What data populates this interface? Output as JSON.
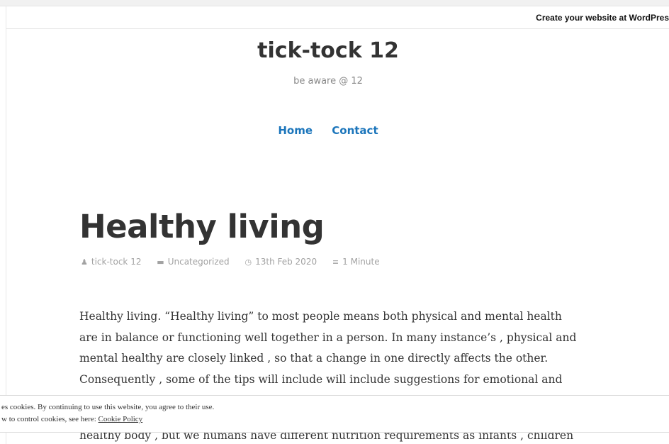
{
  "wpbar": {
    "link_text": "Create your website at WordPres"
  },
  "site": {
    "title": "tick-tock 12",
    "tagline": "be aware @ 12"
  },
  "nav": {
    "items": [
      "Home",
      "Contact"
    ]
  },
  "post": {
    "title": "Healthy living",
    "meta": {
      "author": "tick-tock 12",
      "category": "Uncategorized",
      "date": "13th Feb 2020",
      "reading_time": "1 Minute"
    },
    "paragraph_lines": [
      "Healthy living. “Healthy living” to most people means both physical and mental health",
      "are in balance or functioning well together in a person. In many instance’s , physical and",
      "mental healthy are closely linked , so that a change in one directly affects the other.",
      "Consequently , some of the tips will include will include suggestions for emotional and"
    ],
    "below_text": "healthy body , but we humans have different nutrition requirements as infants , children"
  },
  "cookie": {
    "line1": "es cookies. By continuing to use this website, you agree to their use.",
    "line2_prefix": "w to control cookies, see here: ",
    "policy_link": "Cookie Policy"
  },
  "icons": {
    "author": "person-icon",
    "category": "folder-icon",
    "date": "clock-icon",
    "reading_time": "list-icon"
  },
  "colors": {
    "link": "#1b75bb",
    "text": "#333333",
    "meta": "#a2a2a2"
  }
}
